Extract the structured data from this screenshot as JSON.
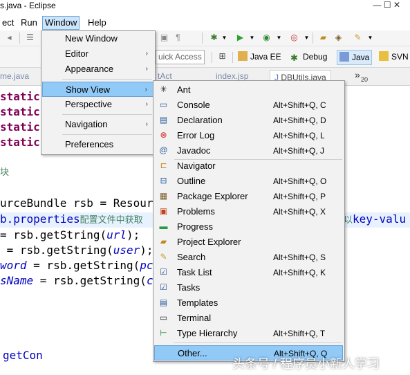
{
  "window": {
    "title": "s.java - Eclipse",
    "controls": "—   ☐   ✕"
  },
  "menubar": {
    "items": [
      "ect",
      "Run",
      "Window",
      "Help"
    ]
  },
  "toolbar": {
    "quick_access": "uick Access"
  },
  "perspectives": [
    {
      "label": "Java EE",
      "icon": "java-ee-icon"
    },
    {
      "label": "Debug",
      "icon": "debug-icon"
    },
    {
      "label": "Java",
      "icon": "java-icon"
    },
    {
      "label": "SVN",
      "icon": "svn-icon"
    }
  ],
  "tabs": {
    "left": "me.java",
    "middle": "tAct",
    "index": "index.jsp",
    "active": "DBUtils.java",
    "overflow": "»",
    "overflow_count": "20"
  },
  "code": {
    "static": "static",
    "block": "块",
    "l1a": "urceBundle rsb = Resour",
    "l2a": "b.properties",
    "l2b": "配置文件中获取",
    "l2c": "以key-valu",
    "l3a": "= rsb.getString(",
    "l3b": "url",
    "l3c": ");",
    "l4a": " = rsb.getString(",
    "l4b": "user",
    "l4c": ");",
    "l5a": "word",
    "l5b": " = rsb.getString(",
    "l5c": "pc",
    "l6a": "sName",
    "l6b": " = rsb.getString(",
    "l6c": "c",
    "getcon": "getCon"
  },
  "window_menu": {
    "items": [
      {
        "label": "New Window",
        "arrow": ""
      },
      {
        "label": "Editor",
        "arrow": "›"
      },
      {
        "label": "Appearance",
        "arrow": "›"
      },
      {
        "label": "Show View",
        "arrow": "›"
      },
      {
        "label": "Perspective",
        "arrow": "›"
      },
      {
        "label": "Navigation",
        "arrow": "›"
      },
      {
        "label": "Preferences",
        "arrow": ""
      }
    ]
  },
  "show_view_menu": {
    "items": [
      {
        "label": "Ant",
        "shortcut": "",
        "icon": "ant-icon"
      },
      {
        "label": "Console",
        "shortcut": "Alt+Shift+Q, C",
        "icon": "console-icon"
      },
      {
        "label": "Declaration",
        "shortcut": "Alt+Shift+Q, D",
        "icon": "declaration-icon"
      },
      {
        "label": "Error Log",
        "shortcut": "Alt+Shift+Q, L",
        "icon": "error-log-icon"
      },
      {
        "label": "Javadoc",
        "shortcut": "Alt+Shift+Q, J",
        "icon": "javadoc-icon"
      },
      {
        "label": "Navigator",
        "shortcut": "",
        "icon": "navigator-icon"
      },
      {
        "label": "Outline",
        "shortcut": "Alt+Shift+Q, O",
        "icon": "outline-icon"
      },
      {
        "label": "Package Explorer",
        "shortcut": "Alt+Shift+Q, P",
        "icon": "package-explorer-icon"
      },
      {
        "label": "Problems",
        "shortcut": "Alt+Shift+Q, X",
        "icon": "problems-icon"
      },
      {
        "label": "Progress",
        "shortcut": "",
        "icon": "progress-icon"
      },
      {
        "label": "Project Explorer",
        "shortcut": "",
        "icon": "project-explorer-icon"
      },
      {
        "label": "Search",
        "shortcut": "Alt+Shift+Q, S",
        "icon": "search-icon"
      },
      {
        "label": "Task List",
        "shortcut": "Alt+Shift+Q, K",
        "icon": "task-list-icon"
      },
      {
        "label": "Tasks",
        "shortcut": "",
        "icon": "tasks-icon"
      },
      {
        "label": "Templates",
        "shortcut": "",
        "icon": "templates-icon"
      },
      {
        "label": "Terminal",
        "shortcut": "",
        "icon": "terminal-icon"
      },
      {
        "label": "Type Hierarchy",
        "shortcut": "Alt+Shift+Q, T",
        "icon": "type-hierarchy-icon"
      },
      {
        "label": "Other...",
        "shortcut": "Alt+Shift+Q, Q",
        "icon": ""
      }
    ]
  },
  "watermark": "头条号 / 程序员小新人学习",
  "colors": {
    "menu_highlight": "#91c9f7",
    "menu_bg": "#f2f2f2",
    "keyword": "#7f0055",
    "field": "#0000c0"
  }
}
